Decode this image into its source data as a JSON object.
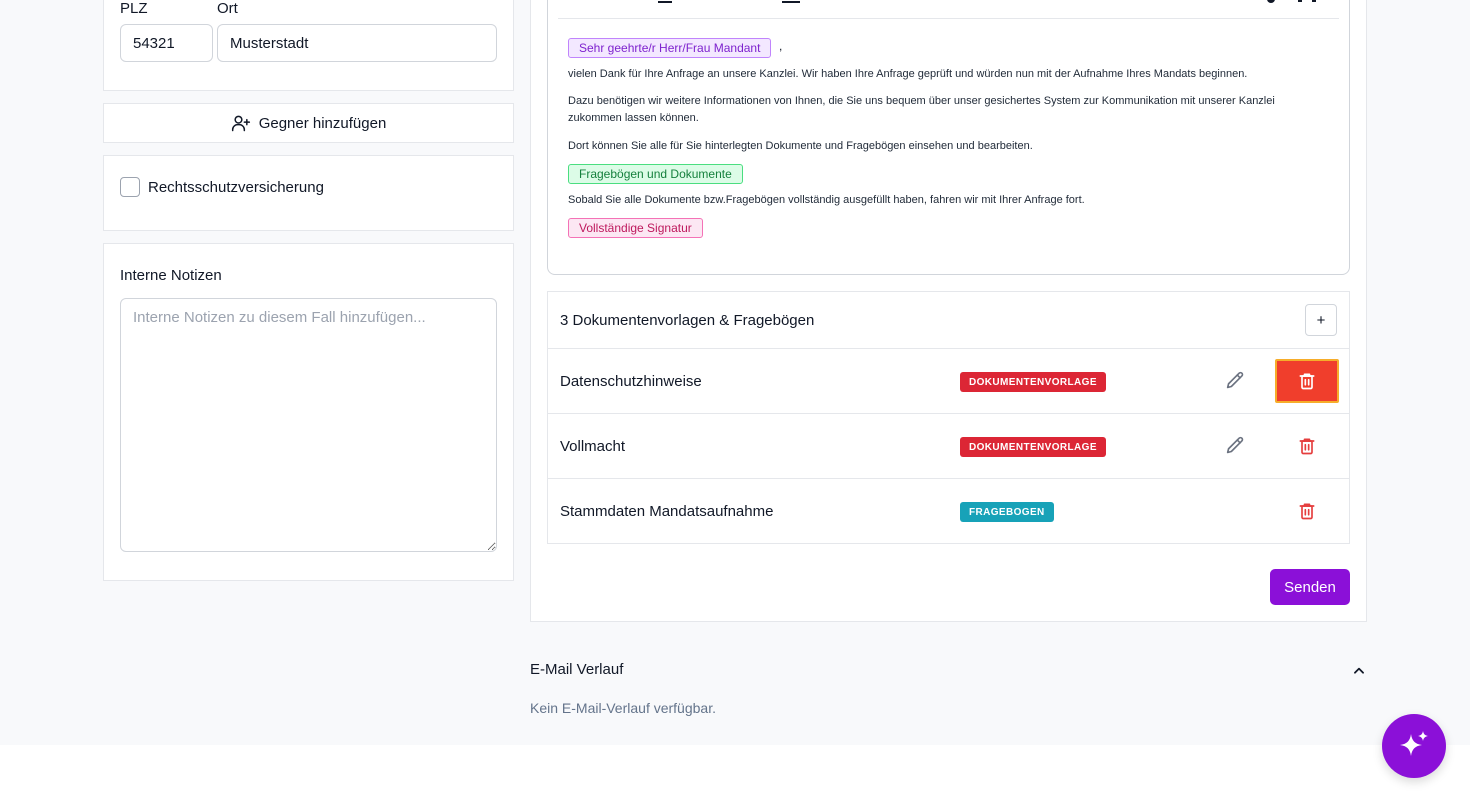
{
  "address": {
    "plz_label": "PLZ",
    "plz_value": "54321",
    "ort_label": "Ort",
    "ort_value": "Musterstadt"
  },
  "opponent": {
    "add_label": "Gegner hinzufügen",
    "icon": "user-plus-icon"
  },
  "insurance": {
    "label": "Rechtsschutzversicherung",
    "checked": false
  },
  "notes": {
    "title": "Interne Notizen",
    "placeholder": "Interne Notizen zu diesem Fall hinzufügen..."
  },
  "email_editor": {
    "tag_salutation": "Sehr geehrte/r Herr/Frau Mandant",
    "comma": ",",
    "para1": "vielen Dank für Ihre Anfrage an unsere Kanzlei. Wir haben Ihre Anfrage geprüft und würden nun mit der Aufnahme Ihres Mandats beginnen.",
    "para2": "Dazu benötigen wir weitere Informationen von Ihnen, die Sie uns bequem über unser gesichertes System zur Kommunikation mit unserer Kanzlei zukommen lassen können.",
    "para3": "Dort können Sie alle für Sie hinterlegten Dokumente und Fragebögen einsehen und bearbeiten.",
    "tag_documents": "Fragebögen und Dokumente",
    "para4": "Sobald Sie alle Dokumente bzw.Fragebögen vollständig ausgefüllt haben, fahren wir mit Ihrer Anfrage fort.",
    "tag_signature": "Vollständige Signatur"
  },
  "documents": {
    "header": "3 Dokumentenvorlagen & Fragebögen",
    "add_label": "+",
    "rows": [
      {
        "name": "Datenschutzhinweise",
        "type": "DOKUMENTENVORLAGE",
        "type_color": "#dc2635",
        "editable": true,
        "delete_active": true
      },
      {
        "name": "Vollmacht",
        "type": "DOKUMENTENVORLAGE",
        "type_color": "#dc2635",
        "editable": true,
        "delete_active": false
      },
      {
        "name": "Stammdaten Mandatsaufnahme",
        "type": "FRAGEBOGEN",
        "type_color": "#17a2b8",
        "editable": false,
        "delete_active": false
      }
    ]
  },
  "send_label": "Senden",
  "email_history": {
    "title": "E-Mail Verlauf",
    "empty_text": "Kein E-Mail-Verlauf verfügbar."
  },
  "colors": {
    "primary": "#8b10d8",
    "danger": "#e53e3e",
    "danger_active_bg": "#f03e2c"
  },
  "fab_icon": "sparkles-icon"
}
